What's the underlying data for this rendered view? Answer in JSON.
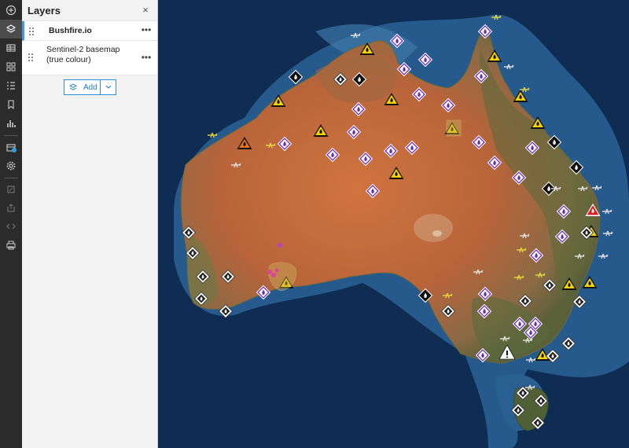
{
  "panel": {
    "title": "Layers",
    "close_glyph": "×",
    "layers": [
      {
        "label": "Bushfire.io",
        "menu_glyph": "•••",
        "selected": true
      },
      {
        "label": "Sentinel-2 basemap (true colour)",
        "menu_glyph": "•••",
        "selected": false
      }
    ],
    "add_label": "Add"
  },
  "toolbar": {
    "icons": [
      "add-icon",
      "layers-icon",
      "table-icon",
      "widget-icon",
      "legend-icon",
      "bookmark-icon",
      "chart-icon",
      "basemap-icon",
      "settings-icon",
      "share-icon",
      "export-icon",
      "embed-icon",
      "print-icon"
    ]
  },
  "map": {
    "basemap": "Sentinel-2 true colour",
    "markers": {
      "fire-hazard-diamond": "purple",
      "warning-triangle": "yellow",
      "watch-and-act-diamond": "black",
      "advice-diamond": "white",
      "emergency-triangle": "red"
    },
    "colors": {
      "ocean": "#0e2a4e",
      "shelf": "#2a5f92",
      "land": "#c46a3c",
      "vegetation": "#4b5d35",
      "purple_marker": "#6a2bb0",
      "yellow_marker": "#f5d300",
      "accent": "#2b8fd9"
    }
  }
}
